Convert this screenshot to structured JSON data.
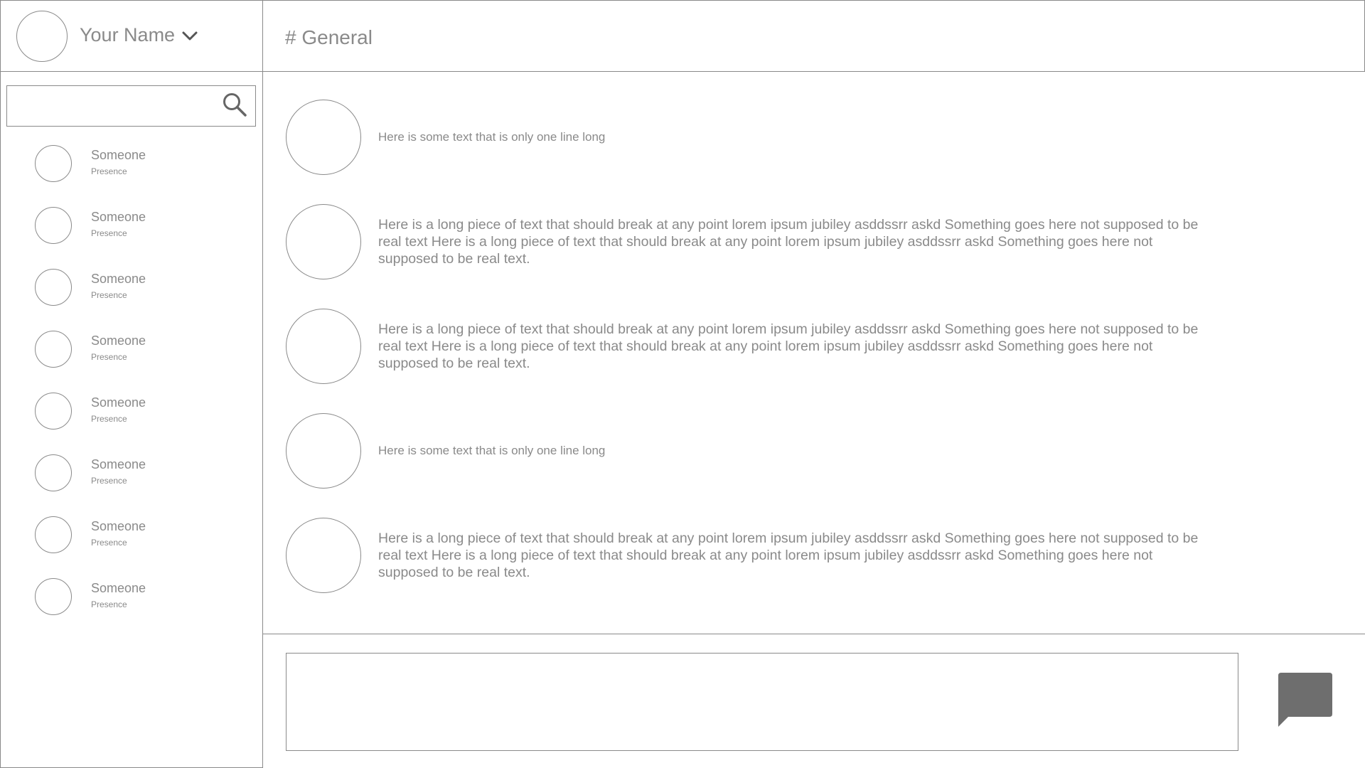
{
  "user": {
    "name": "Your Name"
  },
  "channel": {
    "name": "# General"
  },
  "search": {
    "placeholder": ""
  },
  "contacts": [
    {
      "name": "Someone",
      "presence": "Presence"
    },
    {
      "name": "Someone",
      "presence": "Presence"
    },
    {
      "name": "Someone",
      "presence": "Presence"
    },
    {
      "name": "Someone",
      "presence": "Presence"
    },
    {
      "name": "Someone",
      "presence": "Presence"
    },
    {
      "name": "Someone",
      "presence": "Presence"
    },
    {
      "name": "Someone",
      "presence": "Presence"
    },
    {
      "name": "Someone",
      "presence": "Presence"
    }
  ],
  "messages": [
    {
      "text": "Here is some text that is only one line long"
    },
    {
      "text": "Here is a long piece of text that should break at any point lorem ipsum jubiley asddssrr askd  Something goes here not supposed to be real text Here is a long piece of text that should break at any point lorem ipsum jubiley asddssrr askd  Something goes here not supposed to be real text."
    },
    {
      "text": "Here is a long piece of text that should break at any point lorem ipsum jubiley asddssrr askd  Something goes here not supposed to be real text Here is a long piece of text that should break at any point lorem ipsum jubiley asddssrr askd  Something goes here not supposed to be real text."
    },
    {
      "text": "Here is some text that is only one line long"
    },
    {
      "text": "Here is a long piece of text that should break at any point lorem ipsum jubiley asddssrr askd  Something goes here not supposed to be real text Here is a long piece of text that should break at any point lorem ipsum jubiley asddssrr askd  Something goes here not supposed to be real text."
    }
  ],
  "compose": {
    "value": "",
    "placeholder": ""
  },
  "icons": {
    "user_menu": "chevron-down-icon",
    "search": "search-icon",
    "send": "speech-bubble-icon"
  },
  "colors": {
    "line": "#8a8a8a",
    "text": "#8a8a8a",
    "send_fill": "#6e6e6e",
    "background": "#ffffff"
  }
}
